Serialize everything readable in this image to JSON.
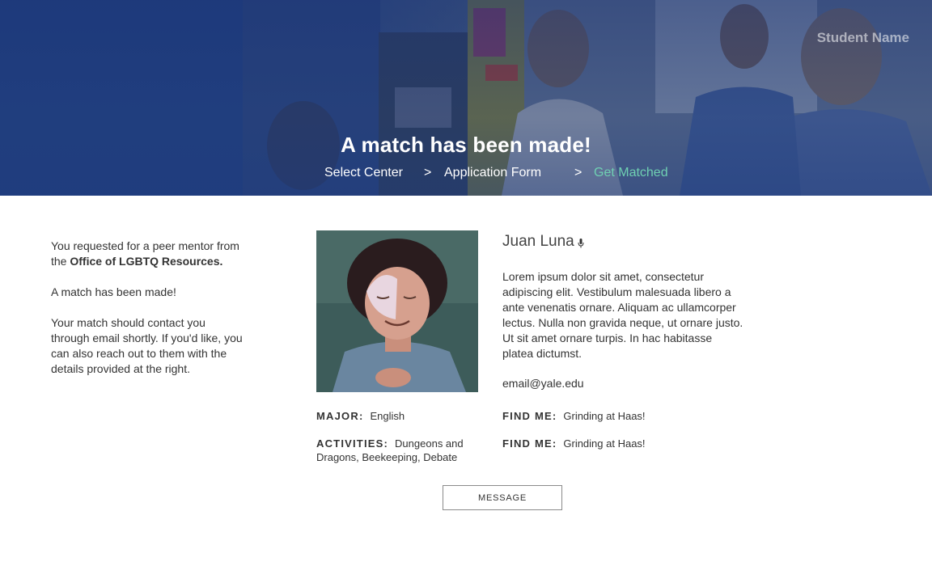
{
  "header": {
    "student_name": "Student Name",
    "title": "A match has been made!",
    "breadcrumb": {
      "step1": "Select Center",
      "sep1": ">",
      "step2": "Application Form",
      "sep2": ">",
      "step3": "Get Matched"
    },
    "active_step_color": "#6fd0b2"
  },
  "intro": {
    "request_prefix": "You requested for a peer mentor from the ",
    "office": "Office of LGBTQ Resources.",
    "matched": "A match has been made!",
    "contact_note": "Your match should contact you through email shortly. If you'd like, you can also reach out to them with the details provided at the right."
  },
  "mentor": {
    "name": "Juan Luna",
    "name_icon": "microphone-icon",
    "bio": "Lorem ipsum dolor sit amet, consectetur adipiscing elit. Vestibulum malesuada libero a ante venenatis ornare. Aliquam ac ullamcorper lectus. Nulla non gravida neque, ut ornare justo. Ut sit amet ornare turpis. In hac habitasse platea dictumst.",
    "email": "email@yale.edu",
    "major_label": "MAJOR:",
    "major": "English",
    "activities_label": "ACTIVITIES:",
    "activities": "Dungeons and Dragons, Beekeeping, Debate",
    "find_me_label_1": "FIND ME:",
    "find_me_1": "Grinding at Haas!",
    "find_me_label_2": "FIND ME:",
    "find_me_2": "Grinding at Haas!"
  },
  "actions": {
    "message_label": "MESSAGE"
  },
  "colors": {
    "hero_blue": "#1b3778",
    "accent_green": "#6fd0b2"
  }
}
